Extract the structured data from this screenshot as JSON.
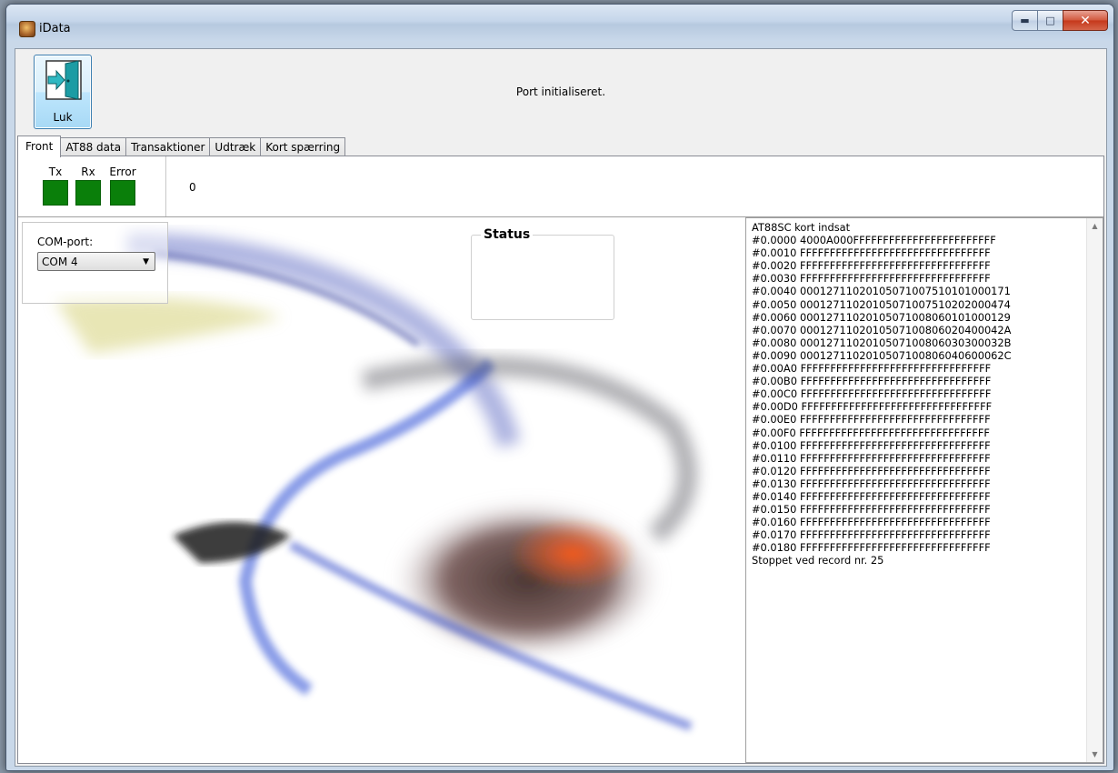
{
  "window": {
    "title": "iData"
  },
  "toolbar": {
    "close_label": "Luk",
    "status_message": "Port initialiseret."
  },
  "tabs": [
    {
      "label": "Front",
      "active": true
    },
    {
      "label": "AT88 data",
      "active": false
    },
    {
      "label": "Transaktioner",
      "active": false
    },
    {
      "label": "Udtræk",
      "active": false
    },
    {
      "label": "Kort spærring",
      "active": false
    }
  ],
  "indicators": {
    "tx_label": "Tx",
    "rx_label": "Rx",
    "error_label": "Error",
    "led_color": "#0a7f0a",
    "counter": "0"
  },
  "com": {
    "label": "COM-port:",
    "selected": "COM 4"
  },
  "status_group": {
    "title": "Status"
  },
  "log": {
    "lines": [
      "AT88SC kort indsat",
      "#0.0000 4000A000FFFFFFFFFFFFFFFFFFFFFFFF",
      "#0.0010 FFFFFFFFFFFFFFFFFFFFFFFFFFFFFFFF",
      "#0.0020 FFFFFFFFFFFFFFFFFFFFFFFFFFFFFFFF",
      "#0.0030 FFFFFFFFFFFFFFFFFFFFFFFFFFFFFFFF",
      "#0.0040 0001271102010507100751010100017 1",
      "#0.0050 00012711020105071007510202000474",
      "#0.0060 00012711020105071008060101000129",
      "#0.0070 0001271102010507100806020400042A",
      "#0.0080 0001271102010507100806030300032B",
      "#0.0090 0001271102010507100806040600062C",
      "#0.00A0 FFFFFFFFFFFFFFFFFFFFFFFFFFFFFFFF",
      "#0.00B0 FFFFFFFFFFFFFFFFFFFFFFFFFFFFFFFF",
      "#0.00C0 FFFFFFFFFFFFFFFFFFFFFFFFFFFFFFFF",
      "#0.00D0 FFFFFFFFFFFFFFFFFFFFFFFFFFFFFFFF",
      "#0.00E0 FFFFFFFFFFFFFFFFFFFFFFFFFFFFFFFF",
      "#0.00F0 FFFFFFFFFFFFFFFFFFFFFFFFFFFFFFFF",
      "#0.0100 FFFFFFFFFFFFFFFFFFFFFFFFFFFFFFFF",
      "#0.0110 FFFFFFFFFFFFFFFFFFFFFFFFFFFFFFFF",
      "#0.0120 FFFFFFFFFFFFFFFFFFFFFFFFFFFFFFFF",
      "#0.0130 FFFFFFFFFFFFFFFFFFFFFFFFFFFFFFFF",
      "#0.0140 FFFFFFFFFFFFFFFFFFFFFFFFFFFFFFFF",
      "#0.0150 FFFFFFFFFFFFFFFFFFFFFFFFFFFFFFFF",
      "#0.0160 FFFFFFFFFFFFFFFFFFFFFFFFFFFFFFFF",
      "#0.0170 FFFFFFFFFFFFFFFFFFFFFFFFFFFFFFFF",
      "#0.0180 FFFFFFFFFFFFFFFFFFFFFFFFFFFFFFFF",
      "Stoppet ved record nr. 25"
    ]
  }
}
